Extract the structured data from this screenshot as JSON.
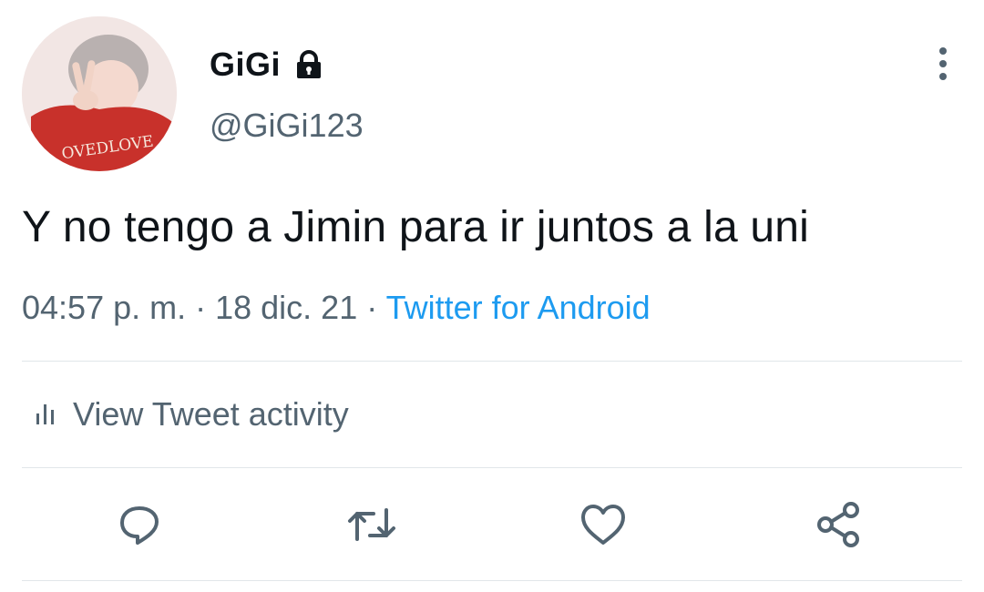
{
  "tweet": {
    "author": {
      "display_name": "GiGi",
      "handle": "@GiGi123",
      "avatar_text": "OVEDLOVE",
      "protected_icon": "lock-icon"
    },
    "text": "Y no tengo a Jimin para ir juntos a la uni",
    "timestamp": "04:57 p. m. · 18 dic. 21 · ",
    "source": "Twitter for Android",
    "activity_label": "View Tweet activity"
  },
  "actions": [
    {
      "icon": "reply-icon"
    },
    {
      "icon": "retweet-icon"
    },
    {
      "icon": "like-icon"
    },
    {
      "icon": "share-icon"
    }
  ],
  "colors": {
    "text_primary": "#0f1419",
    "text_secondary": "#536471",
    "link": "#1d9bf0",
    "divider": "#e1e6ea",
    "avatar_accent": "#c8312b"
  }
}
